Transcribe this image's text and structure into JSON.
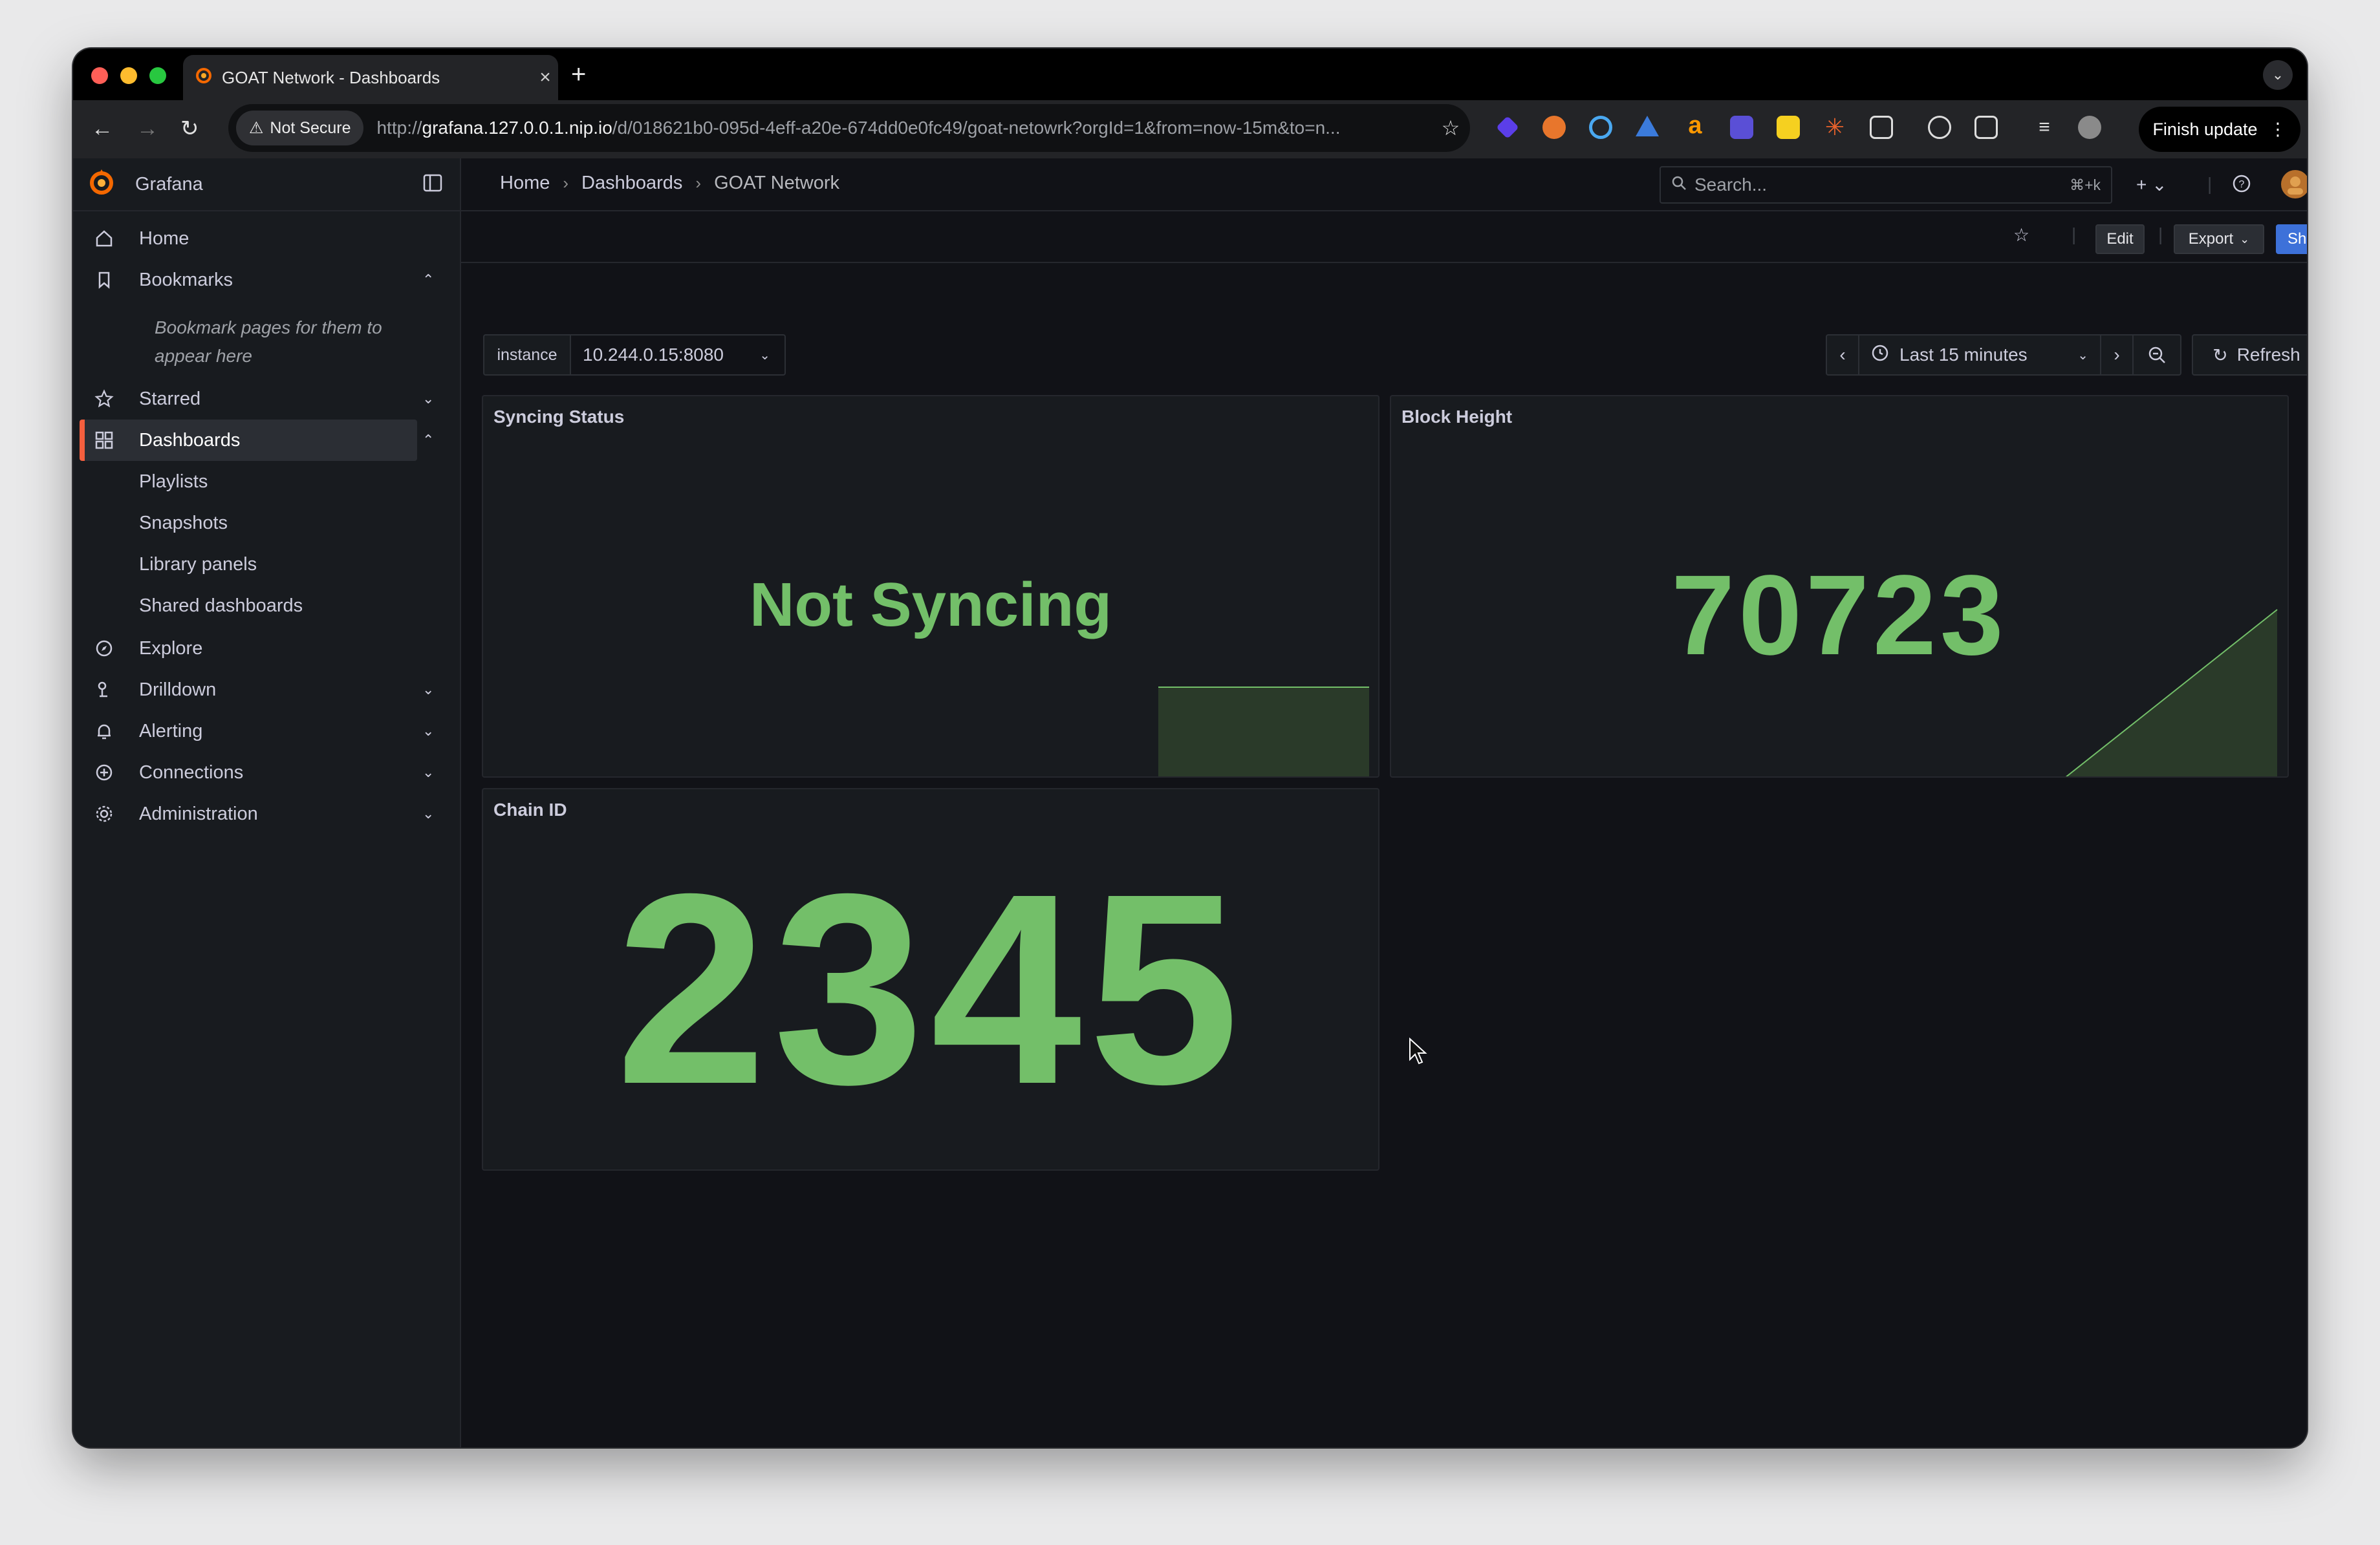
{
  "browser": {
    "tab_title": "GOAT Network - Dashboards",
    "new_tab_label": "+",
    "security_label": "Not Secure",
    "url_prefix": "http://",
    "url_host": "grafana.127.0.0.1.nip.io",
    "url_path": "/d/018621b0-095d-4eff-a20e-674dd0e0fc49/goat-netowrk?orgId=1&from=now-15m&to=n...",
    "finish_update_label": "Finish update",
    "extension_icons": [
      "purple-diamond-icon",
      "fox-icon",
      "ring-icon",
      "triangle-icon",
      "amazon-icon",
      "tdk-icon",
      "dollar-icon",
      "asterisk-icon",
      "puzzle-icon",
      "screenshot-icon",
      "reader-icon",
      "playlist-icon",
      "profile-icon"
    ]
  },
  "sidebar": {
    "brand": "Grafana",
    "items": [
      {
        "key": "home",
        "label": "Home",
        "icon": "home-icon",
        "expandable": false
      },
      {
        "key": "bookmarks",
        "label": "Bookmarks",
        "icon": "bookmark-icon",
        "expandable": true,
        "expanded": true
      },
      {
        "key": "starred",
        "label": "Starred",
        "icon": "star-icon",
        "expandable": true,
        "expanded": false
      },
      {
        "key": "dashboards",
        "label": "Dashboards",
        "icon": "apps-icon",
        "expandable": true,
        "expanded": true,
        "active": true
      },
      {
        "key": "explore",
        "label": "Explore",
        "icon": "compass-icon",
        "expandable": false
      },
      {
        "key": "drilldown",
        "label": "Drilldown",
        "icon": "drilldown-icon",
        "expandable": true,
        "expanded": false
      },
      {
        "key": "alerting",
        "label": "Alerting",
        "icon": "bell-icon",
        "expandable": true,
        "expanded": false
      },
      {
        "key": "connections",
        "label": "Connections",
        "icon": "connections-icon",
        "expandable": true,
        "expanded": false
      },
      {
        "key": "administration",
        "label": "Administration",
        "icon": "cog-icon",
        "expandable": true,
        "expanded": false
      }
    ],
    "bookmarks_hint": "Bookmark pages for them to appear here",
    "dashboard_children": [
      "Playlists",
      "Snapshots",
      "Library panels",
      "Shared dashboards"
    ]
  },
  "topbar": {
    "breadcrumbs": [
      "Home",
      "Dashboards",
      "GOAT Network"
    ],
    "search_placeholder": "Search...",
    "search_shortcut": "⌘+k"
  },
  "actions": {
    "edit_label": "Edit",
    "export_label": "Export",
    "share_label": "Share"
  },
  "variables": {
    "instance_label": "instance",
    "instance_value": "10.244.0.15:8080"
  },
  "time_picker": {
    "range_label": "Last 15 minutes",
    "refresh_label": "Refresh"
  },
  "panels": {
    "syncing": {
      "title": "Syncing Status",
      "value": "Not Syncing"
    },
    "block_height": {
      "title": "Block Height",
      "value": "70723"
    },
    "chain_id": {
      "title": "Chain ID",
      "value": "2345"
    }
  },
  "colors": {
    "stat_green": "#73bf69",
    "accent_orange": "#f55f3e",
    "primary_blue": "#3d71d9",
    "panel_bg": "#181b1f",
    "page_bg": "#111217"
  }
}
